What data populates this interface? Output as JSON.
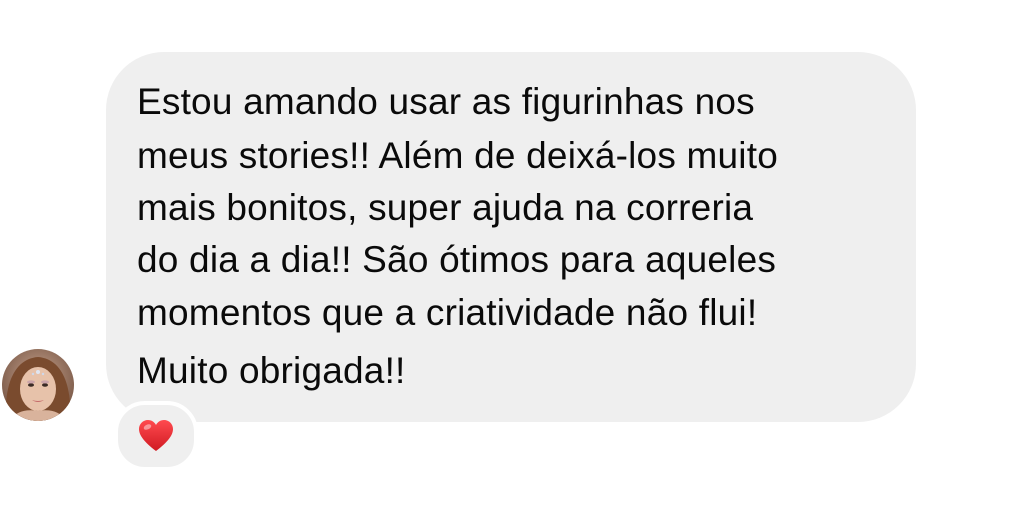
{
  "message": {
    "lines": [
      "Estou amando usar as figurinhas nos",
      "meus stories!! Além de deixá-los muito",
      "mais bonitos, super ajuda na correria",
      "do dia a dia!! São ótimos para aqueles",
      "momentos que a criatividade não flui!",
      "Muito obrigada!!"
    ]
  },
  "reaction": {
    "emoji": "heart-icon",
    "color": "#e0242d"
  },
  "colors": {
    "bubble": "#efefef",
    "text": "#0a0a0a",
    "background": "#ffffff"
  }
}
